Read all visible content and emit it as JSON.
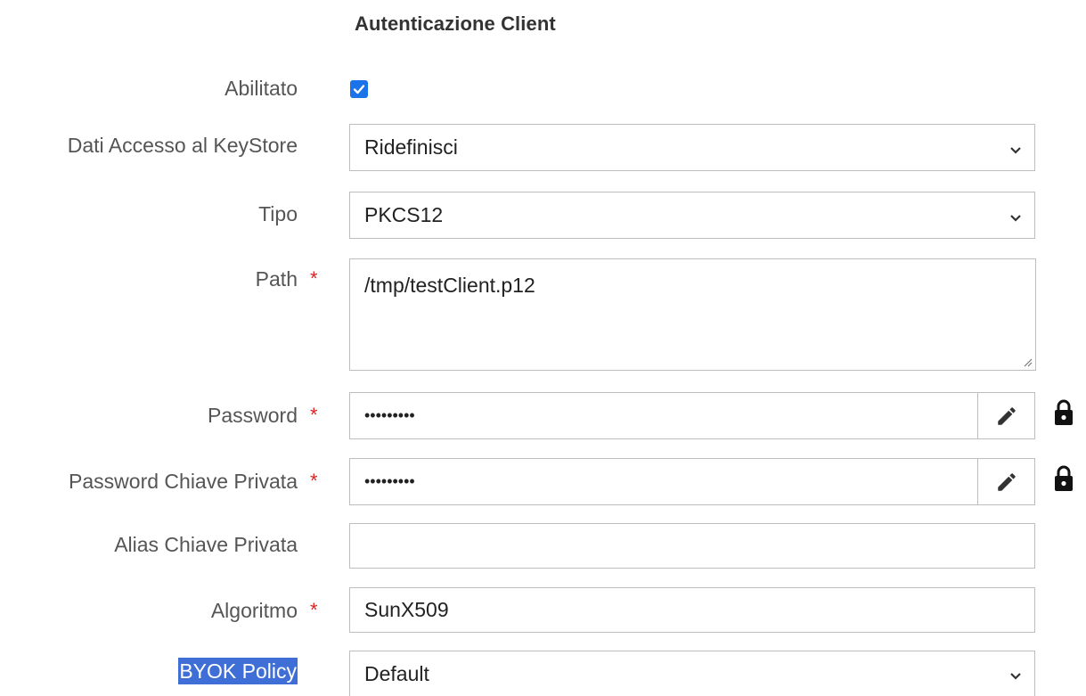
{
  "section": {
    "title": "Autenticazione Client"
  },
  "fields": {
    "abilitato": {
      "label": "Abilitato",
      "checked": true
    },
    "dati_accesso": {
      "label": "Dati Accesso al KeyStore",
      "value": "Ridefinisci"
    },
    "tipo": {
      "label": "Tipo",
      "value": "PKCS12"
    },
    "path": {
      "label": "Path",
      "required_mark": "*",
      "value": "/tmp/testClient.p12"
    },
    "password": {
      "label": "Password",
      "required_mark": "*",
      "value": "•••••••••"
    },
    "password_chiave": {
      "label": "Password Chiave Privata",
      "required_mark": "*",
      "value": "•••••••••"
    },
    "alias_chiave": {
      "label": "Alias Chiave Privata",
      "value": ""
    },
    "algoritmo": {
      "label": "Algoritmo",
      "required_mark": "*",
      "value": "SunX509"
    },
    "byok_policy": {
      "label": "BYOK Policy",
      "value": "Default"
    }
  },
  "icons": {
    "edit": "pencil-icon",
    "lock": "lock-icon",
    "dropdown": "chevron-down-icon",
    "check": "check-icon"
  },
  "colors": {
    "required": "#e02020",
    "checkbox": "#1a73e8",
    "selection_highlight": "#3f6fd6"
  }
}
